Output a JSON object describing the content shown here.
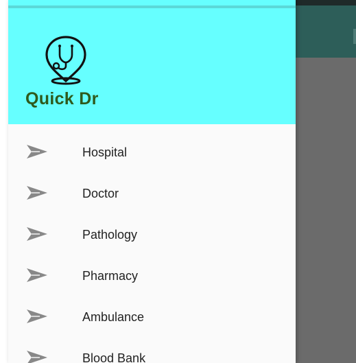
{
  "app": {
    "name": "Quick Dr",
    "logo_icon": "stethoscope-pin-icon"
  },
  "colors": {
    "header_bg": "#66ffff",
    "app_name_color": "#2e5a1c",
    "drawer_bg": "#fafafa",
    "scrim": "#6b6b6b",
    "appbar": "#2d5e59",
    "menu_icon_color": "#888888"
  },
  "drawer": {
    "items": [
      {
        "label": "Hospital",
        "icon": "send-icon"
      },
      {
        "label": "Doctor",
        "icon": "send-icon"
      },
      {
        "label": "Pathology",
        "icon": "send-icon"
      },
      {
        "label": "Pharmacy",
        "icon": "send-icon"
      },
      {
        "label": "Ambulance",
        "icon": "send-icon"
      },
      {
        "label": "Blood Bank",
        "icon": "send-icon"
      }
    ]
  }
}
